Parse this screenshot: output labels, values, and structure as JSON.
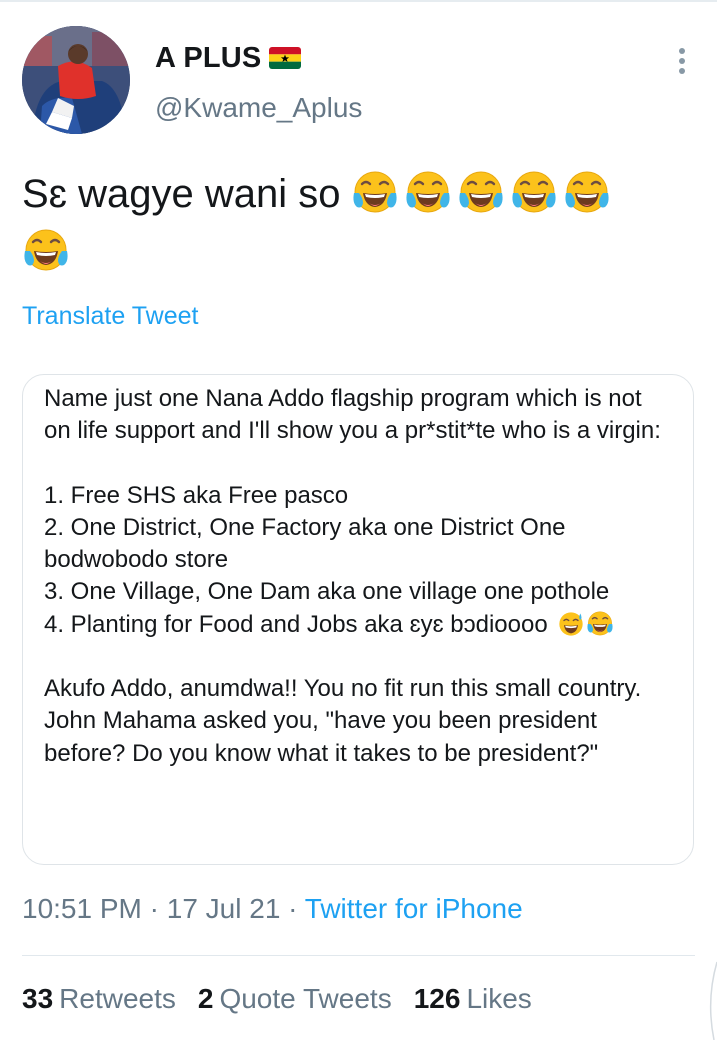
{
  "user": {
    "display_name": "A PLUS",
    "handle": "@Kwame_Aplus",
    "flag_icon": "ghana-flag-icon"
  },
  "tweet": {
    "text": "Sɛ wagye wani so",
    "emoji_icon": "face-with-tears-of-joy-icon",
    "emoji_count": 6,
    "translate_label": "Translate Tweet"
  },
  "quote": {
    "intro": "Name just one Nana Addo flagship program which is not on life support and I'll show you a pr*stit*te who is a virgin:",
    "items": [
      "1. Free SHS aka Free pasco",
      "2. One District, One Factory aka one District One bodwobodo store",
      "3. One Village, One Dam aka one village one pothole",
      "4. Planting for Food and Jobs aka ɛyɛ bɔdioooo"
    ],
    "outro": "Akufo Addo, anumdwa!! You no fit run this small country. John Mahama asked you, \"have you been president before? Do you know what it takes to be president?\""
  },
  "meta": {
    "time": "10:51 PM",
    "separator": "·",
    "date": "17 Jul 21",
    "source": "Twitter for iPhone"
  },
  "stats": {
    "retweets_count": "33",
    "retweets_label": "Retweets",
    "quote_tweets_count": "2",
    "quote_tweets_label": "Quote Tweets",
    "likes_count": "126",
    "likes_label": "Likes"
  },
  "colors": {
    "text_primary": "#14171a",
    "text_secondary": "#657786",
    "link": "#1da1f2",
    "border": "#dfe4e8"
  }
}
